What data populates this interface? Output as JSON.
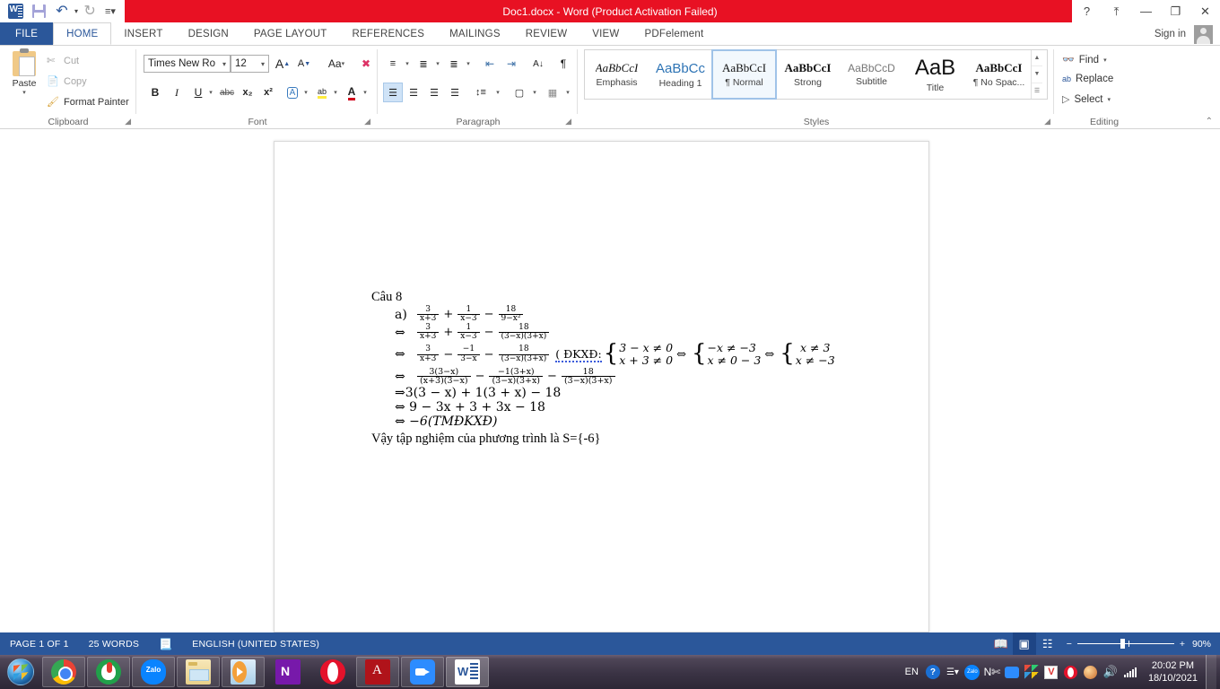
{
  "titlebar": {
    "document_title": "Doc1.docx  -  Word (Product Activation Failed)",
    "quick_access": [
      {
        "name": "save",
        "icon": "save-icon"
      },
      {
        "name": "undo",
        "icon": "undo-icon"
      },
      {
        "name": "redo",
        "icon": "redo-icon"
      },
      {
        "name": "customize",
        "icon": "chevron-down-icon"
      }
    ],
    "help_glyph": "?",
    "ribbon_display_glyph": "⤒",
    "minimize_glyph": "—",
    "restore_glyph": "❐",
    "close_glyph": "✕",
    "signin_label": "Sign in"
  },
  "tabs": [
    {
      "label": "FILE",
      "active": false
    },
    {
      "label": "HOME",
      "active": true
    },
    {
      "label": "INSERT",
      "active": false
    },
    {
      "label": "DESIGN",
      "active": false
    },
    {
      "label": "PAGE LAYOUT",
      "active": false
    },
    {
      "label": "REFERENCES",
      "active": false
    },
    {
      "label": "MAILINGS",
      "active": false
    },
    {
      "label": "REVIEW",
      "active": false
    },
    {
      "label": "VIEW",
      "active": false
    },
    {
      "label": "PDFelement",
      "active": false
    }
  ],
  "ribbon": {
    "clipboard": {
      "group_label": "Clipboard",
      "paste_label": "Paste",
      "cut_label": "Cut",
      "copy_label": "Copy",
      "format_painter_label": "Format Painter"
    },
    "font": {
      "group_label": "Font",
      "font_name": "Times New Ro",
      "font_size": "12",
      "grow_font": "A",
      "shrink_font": "A",
      "change_case": "Aa",
      "clear_formatting": "clear-formatting-icon",
      "bold": "B",
      "italic": "I",
      "underline": "U",
      "strikethrough": "abc",
      "subscript": "x₂",
      "superscript": "x²",
      "text_effects": "A",
      "highlight": "ab",
      "font_color": "A"
    },
    "paragraph": {
      "group_label": "Paragraph",
      "bullets": "bullets-icon",
      "numbering": "numbering-icon",
      "multilevel": "multilevel-list-icon",
      "decrease_indent": "decrease-indent-icon",
      "increase_indent": "increase-indent-icon",
      "sort": "sort-icon",
      "show_marks": "¶",
      "align_left": "align-left-icon",
      "align_center": "align-center-icon",
      "align_right": "align-right-icon",
      "justify": "justify-icon",
      "line_spacing": "line-spacing-icon",
      "shading": "shading-icon",
      "borders": "borders-icon"
    },
    "styles": {
      "group_label": "Styles",
      "items": [
        {
          "preview": "AaBbCcI",
          "name": "Emphasis",
          "selected": false
        },
        {
          "preview": "AaBbCс",
          "name": "Heading 1",
          "selected": false
        },
        {
          "preview": "AaBbCcI",
          "name": "¶ Normal",
          "selected": true
        },
        {
          "preview": "AaBbCcI",
          "name": "Strong",
          "selected": false
        },
        {
          "preview": "AaBbCcD",
          "name": "Subtitle",
          "selected": false
        },
        {
          "preview": "AaB",
          "name": "Title",
          "selected": false
        },
        {
          "preview": "AaBbCcI",
          "name": "¶ No Spac...",
          "selected": false
        }
      ]
    },
    "editing": {
      "group_label": "Editing",
      "find_label": "Find",
      "replace_label": "Replace",
      "select_label": "Select"
    },
    "collapse_glyph": "⌃"
  },
  "document": {
    "heading": "Câu 8",
    "lines": [
      {
        "id": "line-a",
        "label": "a)",
        "terms": [
          {
            "num": "3",
            "den": "x+3"
          },
          {
            "op": "+",
            "num": "1",
            "den": "x−3"
          },
          {
            "op": "−",
            "num": "18",
            "den": "9−x²"
          }
        ]
      },
      {
        "id": "line-2",
        "label": "⇔",
        "terms": [
          {
            "num": "3",
            "den": "x+3"
          },
          {
            "op": "+",
            "num": "1",
            "den": "x−3"
          },
          {
            "op": "−",
            "num": "18",
            "den": "(3−x)(3+x)"
          }
        ]
      },
      {
        "id": "line-3",
        "label": "⇔",
        "terms": [
          {
            "num": "3",
            "den": "x+3"
          },
          {
            "op": "−",
            "num": "−1",
            "den": "3−x"
          },
          {
            "op": "−",
            "num": "18",
            "den": "(3−x)(3+x)"
          }
        ],
        "condition_label": "( ĐKXĐ:",
        "system1": [
          "3 − x ≠ 0",
          "x + 3 ≠ 0"
        ],
        "system2": [
          "−x ≠ −3",
          "x ≠ 0 − 3"
        ],
        "system3": [
          "x ≠ 3",
          "x ≠ −3"
        ],
        "equiv": "⇔"
      },
      {
        "id": "line-4",
        "label": "⇔",
        "terms": [
          {
            "num": "3(3−x)",
            "den": "(x+3)(3−x)"
          },
          {
            "op": "−",
            "num": "−1(3+x)",
            "den": "(3−x)(3+x)"
          },
          {
            "op": "−",
            "num": "18",
            "den": "(3−x)(3+x)"
          }
        ]
      }
    ],
    "plain_lines": [
      "⇒3(3 − x) + 1(3 + x) − 18",
      "⇔ 9 − 3x + 3 + 3x − 18",
      "⇔ −6(TMĐKXĐ)"
    ],
    "conclusion": "Vậy tập nghiệm của phương trình là S={-6}"
  },
  "statusbar": {
    "page_label": "PAGE 1 OF 1",
    "word_count": "25 WORDS",
    "proofing_icon": "proofing-errors-icon",
    "language": "ENGLISH (UNITED STATES)",
    "view_read": "read-mode-icon",
    "view_print": "print-layout-icon",
    "view_web": "web-layout-icon",
    "zoom_out": "−",
    "zoom_in": "+",
    "zoom_level": "90%"
  },
  "taskbar": {
    "start": "start-orb-icon",
    "apps": [
      {
        "name": "chrome",
        "icon": "chrome-icon",
        "running": false
      },
      {
        "name": "green-app",
        "icon": "green-app-icon",
        "running": false
      },
      {
        "name": "zalo",
        "icon": "zalo-icon",
        "running": false
      },
      {
        "name": "file-explorer",
        "icon": "file-explorer-icon",
        "running": false
      },
      {
        "name": "media-player",
        "icon": "media-player-icon",
        "running": false
      },
      {
        "name": "onenote",
        "icon": "onenote-icon",
        "running": false
      },
      {
        "name": "opera",
        "icon": "opera-icon",
        "running": false
      },
      {
        "name": "adobe-reader",
        "icon": "adobe-reader-icon",
        "running": false
      },
      {
        "name": "zoom",
        "icon": "zoom-app-icon",
        "running": false
      },
      {
        "name": "word",
        "icon": "word-icon",
        "running": true
      }
    ],
    "tray": {
      "language": "EN",
      "time": "20:02 PM",
      "date": "18/10/2021"
    }
  },
  "colors": {
    "word_blue": "#2b579a",
    "title_red": "#e81123",
    "accent_selected": "#a0c3e8"
  }
}
